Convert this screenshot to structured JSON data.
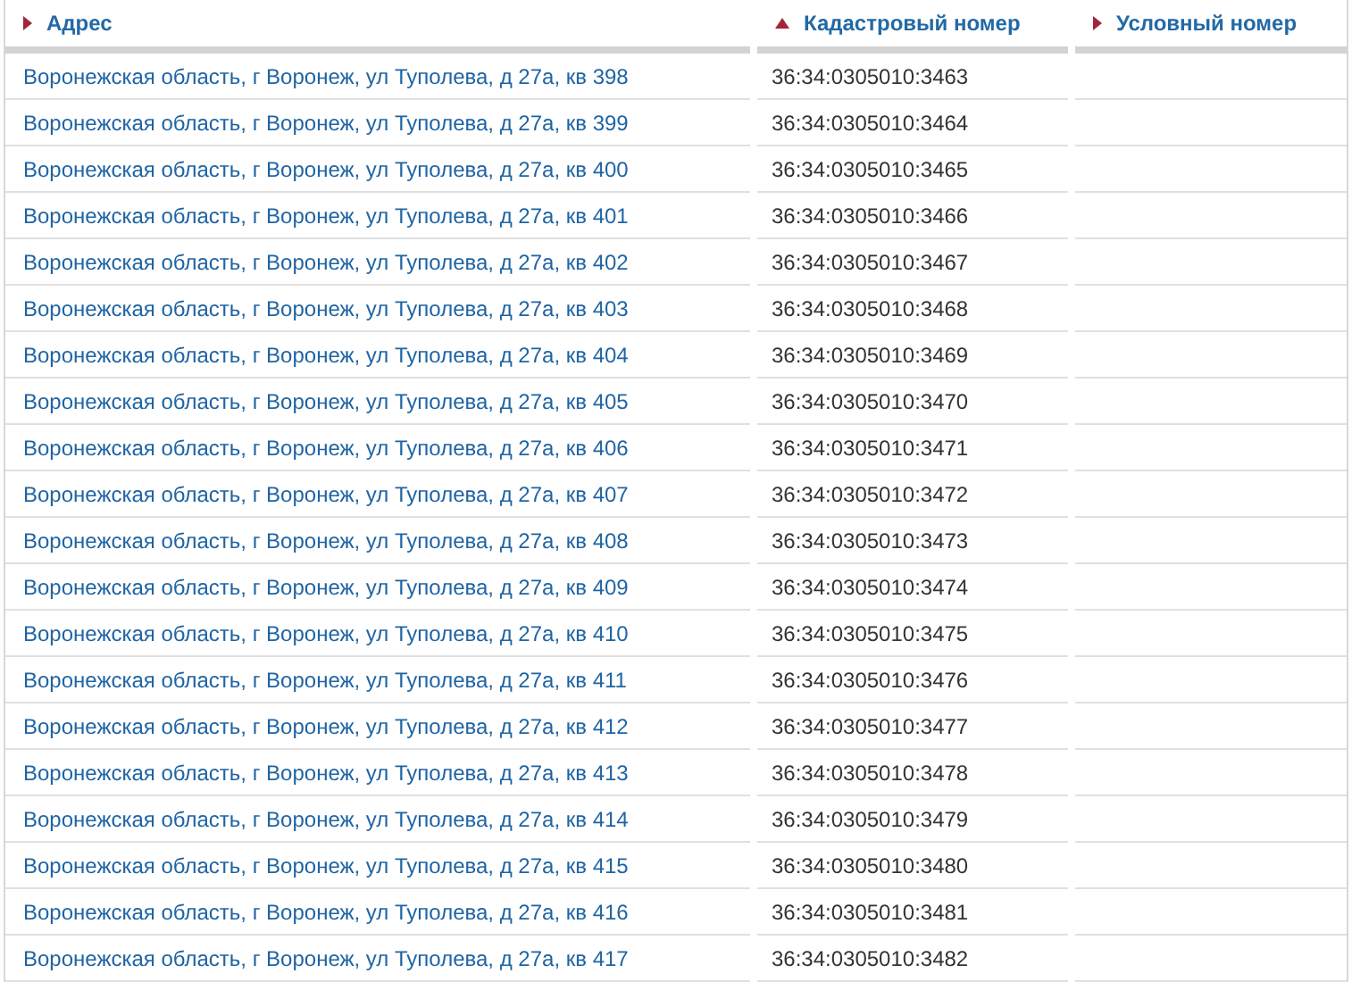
{
  "table": {
    "columns": [
      {
        "label": "Адрес",
        "sorted": false
      },
      {
        "label": "Кадастровый номер",
        "sorted": true
      },
      {
        "label": "Условный номер",
        "sorted": false
      }
    ],
    "rows": [
      {
        "address": "Воронежская область, г Воронеж, ул Туполева, д 27а, кв 398",
        "cadastral_number": "36:34:0305010:3463"
      },
      {
        "address": "Воронежская область, г Воронеж, ул Туполева, д 27а, кв 399",
        "cadastral_number": "36:34:0305010:3464"
      },
      {
        "address": "Воронежская область, г Воронеж, ул Туполева, д 27а, кв 400",
        "cadastral_number": "36:34:0305010:3465"
      },
      {
        "address": "Воронежская область, г Воронеж, ул Туполева, д 27а, кв 401",
        "cadastral_number": "36:34:0305010:3466"
      },
      {
        "address": "Воронежская область, г Воронеж, ул Туполева, д 27а, кв 402",
        "cadastral_number": "36:34:0305010:3467"
      },
      {
        "address": "Воронежская область, г Воронеж, ул Туполева, д 27а, кв 403",
        "cadastral_number": "36:34:0305010:3468"
      },
      {
        "address": "Воронежская область, г Воронеж, ул Туполева, д 27а, кв 404",
        "cadastral_number": "36:34:0305010:3469"
      },
      {
        "address": "Воронежская область, г Воронеж, ул Туполева, д 27а, кв 405",
        "cadastral_number": "36:34:0305010:3470"
      },
      {
        "address": "Воронежская область, г Воронеж, ул Туполева, д 27а, кв 406",
        "cadastral_number": "36:34:0305010:3471"
      },
      {
        "address": "Воронежская область, г Воронеж, ул Туполева, д 27а, кв 407",
        "cadastral_number": "36:34:0305010:3472"
      },
      {
        "address": "Воронежская область, г Воронеж, ул Туполева, д 27а, кв 408",
        "cadastral_number": "36:34:0305010:3473"
      },
      {
        "address": "Воронежская область, г Воронеж, ул Туполева, д 27а, кв 409",
        "cadastral_number": "36:34:0305010:3474"
      },
      {
        "address": "Воронежская область, г Воронеж, ул Туполева, д 27а, кв 410",
        "cadastral_number": "36:34:0305010:3475"
      },
      {
        "address": "Воронежская область, г Воронеж, ул Туполева, д 27а, кв 411",
        "cadastral_number": "36:34:0305010:3476"
      },
      {
        "address": "Воронежская область, г Воронеж, ул Туполева, д 27а, кв 412",
        "cadastral_number": "36:34:0305010:3477"
      },
      {
        "address": "Воронежская область, г Воронеж, ул Туполева, д 27а, кв 413",
        "cadastral_number": "36:34:0305010:3478"
      },
      {
        "address": "Воронежская область, г Воронеж, ул Туполева, д 27а, кв 414",
        "cadastral_number": "36:34:0305010:3479"
      },
      {
        "address": "Воронежская область, г Воронеж, ул Туполева, д 27а, кв 415",
        "cadastral_number": "36:34:0305010:3480"
      },
      {
        "address": "Воронежская область, г Воронеж, ул Туполева, д 27а, кв 416",
        "cadastral_number": "36:34:0305010:3481"
      },
      {
        "address": "Воронежская область, г Воронеж, ул Туполева, д 27а, кв 417",
        "cadastral_number": "36:34:0305010:3482"
      }
    ]
  }
}
